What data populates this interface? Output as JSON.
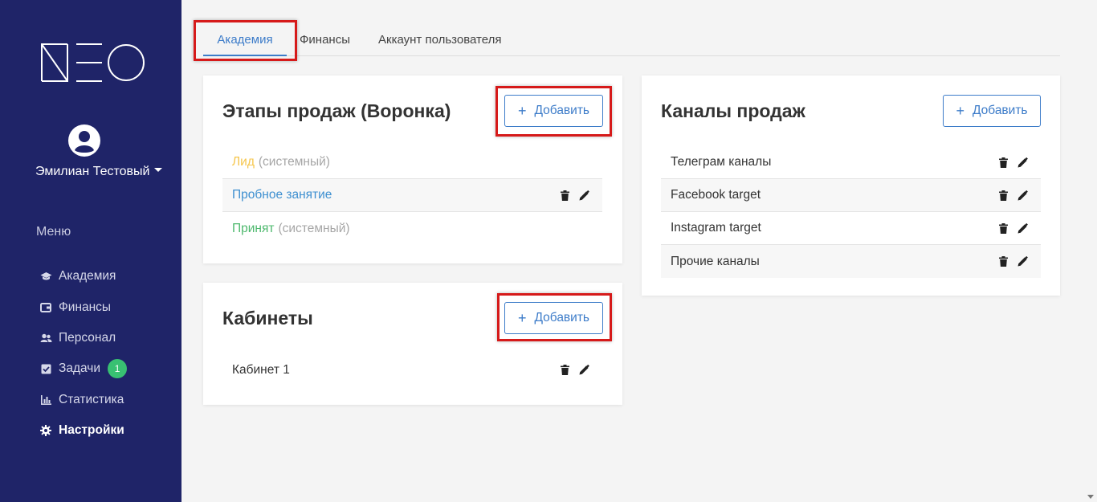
{
  "sidebar": {
    "user_name": "Эмилиан Тестовый",
    "menu_title": "Меню",
    "items": [
      {
        "label": "Академия",
        "icon": "graduation-cap-icon"
      },
      {
        "label": "Финансы",
        "icon": "wallet-icon"
      },
      {
        "label": "Персонал",
        "icon": "users-icon"
      },
      {
        "label": "Задачи",
        "icon": "check-square-icon",
        "badge": "1"
      },
      {
        "label": "Статистика",
        "icon": "bar-chart-icon"
      },
      {
        "label": "Настройки",
        "icon": "gear-icon",
        "active": true
      }
    ],
    "bg_color": "#1f2468"
  },
  "tabs": [
    {
      "label": "Академия",
      "active": true
    },
    {
      "label": "Финансы"
    },
    {
      "label": "Аккаунт пользователя"
    }
  ],
  "add_label": "Добавить",
  "sales_stages": {
    "title": "Этапы продаж (Воронка)",
    "rows": [
      {
        "name": "Лид",
        "suffix": "(системный)"
      },
      {
        "name": "Пробное занятие"
      },
      {
        "name": "Принят",
        "suffix": "(системный)"
      }
    ]
  },
  "rooms": {
    "title": "Кабинеты",
    "rows": [
      {
        "name": "Кабинет 1"
      }
    ]
  },
  "sales_channels": {
    "title": "Каналы продаж",
    "rows": [
      {
        "name": "Телеграм каналы"
      },
      {
        "name": "Facebook target"
      },
      {
        "name": "Instagram target"
      },
      {
        "name": "Прочие каналы"
      }
    ]
  },
  "colors": {
    "accent": "#3d7cc9",
    "highlight": "#d61a1a",
    "badge": "#38c172"
  }
}
